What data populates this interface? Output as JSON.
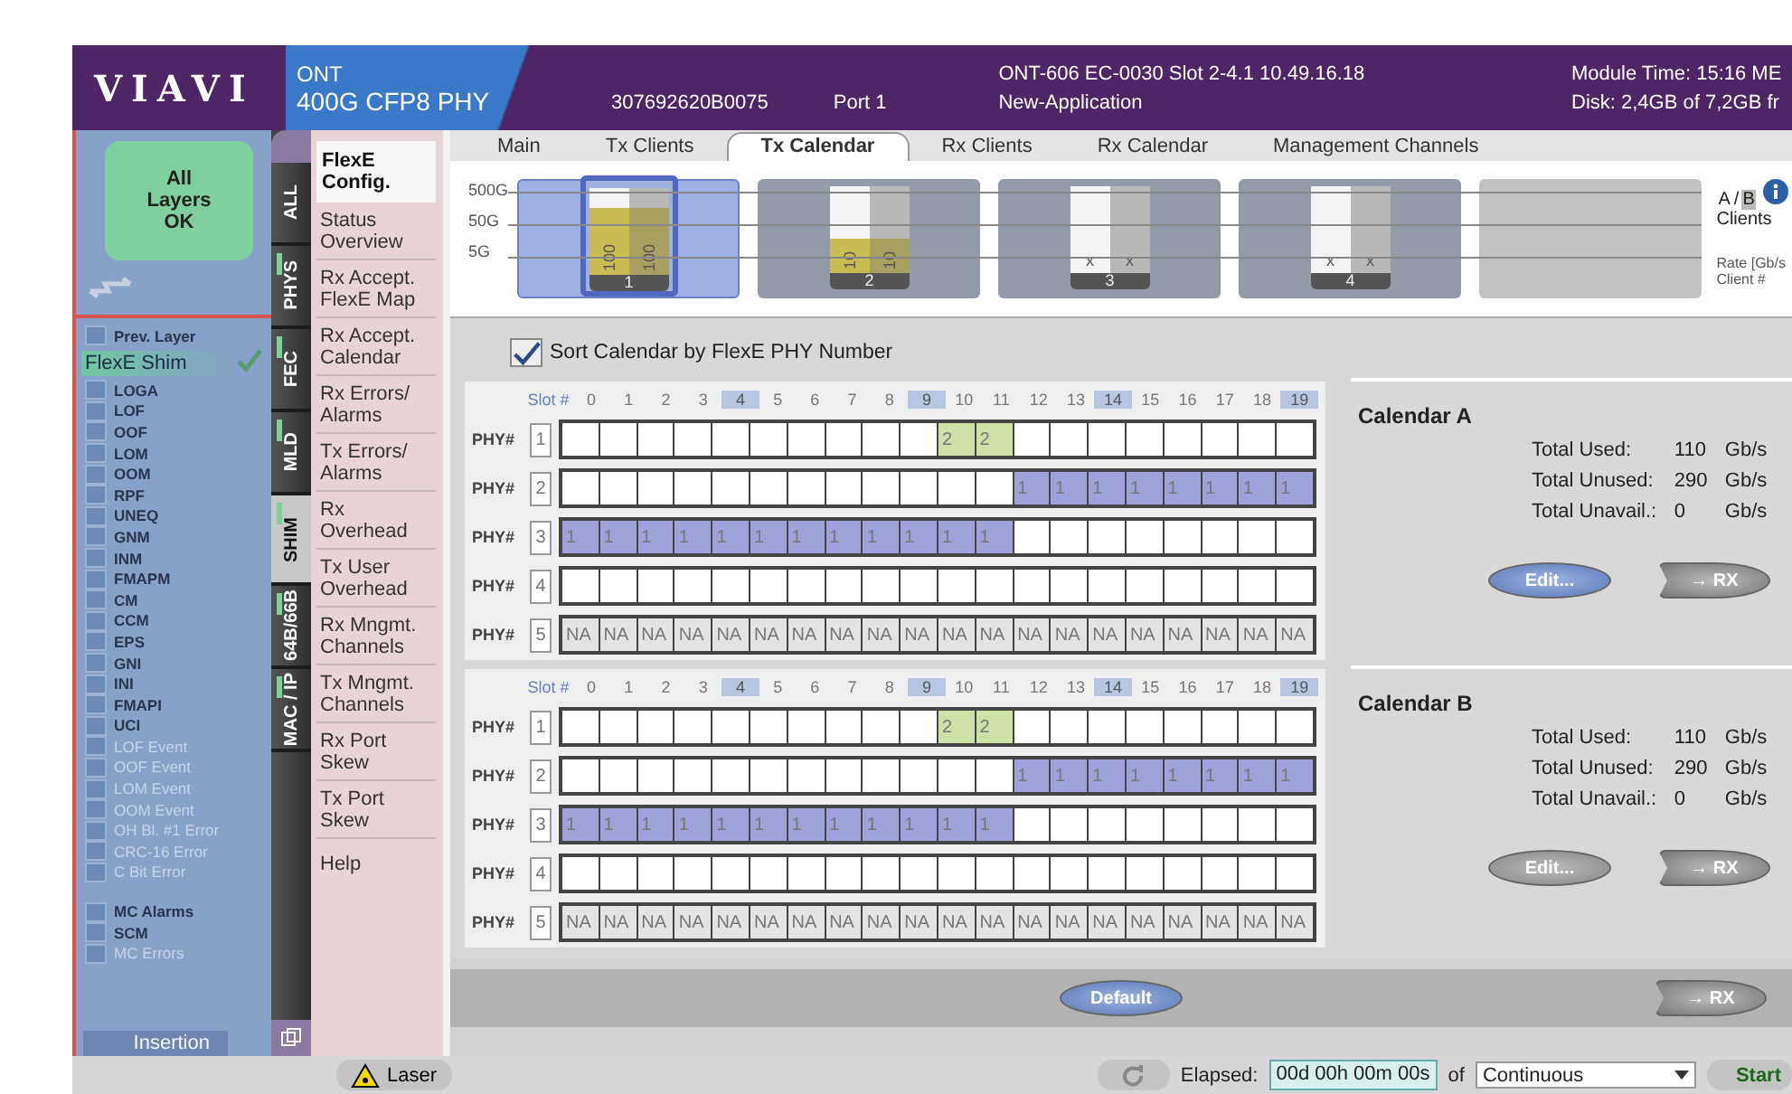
{
  "header": {
    "logo": "VIAVI",
    "product": "ONT",
    "module": "400G CFP8 PHY",
    "serial": "307692620B0075",
    "port": "Port 1",
    "device": "ONT-606 EC-0030 Slot 2-4.1  10.49.16.18",
    "application": "New-Application",
    "module_time": "Module Time: 15:16 ME",
    "disk": "Disk: 2,4GB of 7,2GB fr"
  },
  "status_box": {
    "text": "All Layers OK"
  },
  "prev_layer": {
    "label": "Prev. Layer",
    "checked": false
  },
  "layer": {
    "label": "FlexE Shim",
    "selected": true
  },
  "alarms": [
    {
      "label": "LOGA",
      "disabled": false
    },
    {
      "label": "LOF",
      "disabled": false
    },
    {
      "label": "OOF",
      "disabled": false
    },
    {
      "label": "LOM",
      "disabled": false
    },
    {
      "label": "OOM",
      "disabled": false
    },
    {
      "label": "RPF",
      "disabled": false
    },
    {
      "label": "UNEQ",
      "disabled": false
    },
    {
      "label": "GNM",
      "disabled": false
    },
    {
      "label": "INM",
      "disabled": false
    },
    {
      "label": "FMAPM",
      "disabled": false
    },
    {
      "label": "CM",
      "disabled": false
    },
    {
      "label": "CCM",
      "disabled": false
    },
    {
      "label": "EPS",
      "disabled": false
    },
    {
      "label": "GNI",
      "disabled": false
    },
    {
      "label": "INI",
      "disabled": false
    },
    {
      "label": "FMAPI",
      "disabled": false
    },
    {
      "label": "UCI",
      "disabled": false
    },
    {
      "label": "LOF Event",
      "disabled": true
    },
    {
      "label": "OOF Event",
      "disabled": true
    },
    {
      "label": "LOM Event",
      "disabled": true
    },
    {
      "label": "OOM Event",
      "disabled": true
    },
    {
      "label": "OH Bl. #1 Error",
      "disabled": true
    },
    {
      "label": "CRC-16 Error",
      "disabled": true
    },
    {
      "label": "C Bit Error",
      "disabled": true
    }
  ],
  "mc_alarms": [
    {
      "label": "MC Alarms",
      "disabled": false
    },
    {
      "label": "SCM",
      "disabled": false
    },
    {
      "label": "MC Errors",
      "disabled": true
    }
  ],
  "insertion": {
    "label": "Insertion"
  },
  "layer_tabs": [
    {
      "label": "ALL",
      "selected": false,
      "indicator": false
    },
    {
      "label": "PHYS",
      "selected": false,
      "indicator": true
    },
    {
      "label": "FEC",
      "selected": false,
      "indicator": true
    },
    {
      "label": "MLD",
      "selected": false,
      "indicator": true
    },
    {
      "label": "SHIM",
      "selected": true,
      "indicator": true
    },
    {
      "label": "64B/66B",
      "selected": false,
      "indicator": true
    },
    {
      "label": "MAC / IP",
      "selected": false,
      "indicator": true
    }
  ],
  "menu": [
    {
      "label": "FlexE Config.",
      "selected": true
    },
    {
      "label": "Status Overview",
      "selected": false
    },
    {
      "label": "Rx Accept. FlexE Map",
      "selected": false
    },
    {
      "label": "Rx Accept. Calendar",
      "selected": false
    },
    {
      "label": "Rx Errors/ Alarms",
      "selected": false
    },
    {
      "label": "Tx Errors/ Alarms",
      "selected": false
    },
    {
      "label": "Rx Overhead",
      "selected": false
    },
    {
      "label": "Tx User Overhead",
      "selected": false
    },
    {
      "label": "Rx Mngmt. Channels",
      "selected": false
    },
    {
      "label": "Tx Mngmt. Channels",
      "selected": false
    },
    {
      "label": "Rx Port Skew",
      "selected": false
    },
    {
      "label": "Tx Port Skew",
      "selected": false
    },
    {
      "label": "Help",
      "selected": false
    }
  ],
  "tabs": [
    {
      "label": "Main",
      "selected": false
    },
    {
      "label": "Tx Clients",
      "selected": false
    },
    {
      "label": "Tx Calendar",
      "selected": true
    },
    {
      "label": "Rx Clients",
      "selected": false
    },
    {
      "label": "Rx Calendar",
      "selected": false
    },
    {
      "label": "Management Channels",
      "selected": false
    }
  ],
  "client_chart": {
    "rate_labels": [
      "500G",
      "50G",
      "5G"
    ],
    "groups": [
      {
        "kind": "client",
        "number": "1",
        "selected": true,
        "bars": [
          {
            "text": "100",
            "level": 0.78
          },
          {
            "text": "100",
            "level": 0.78
          }
        ]
      },
      {
        "kind": "client",
        "number": "2",
        "selected": false,
        "bars": [
          {
            "text": "10",
            "level": 0.4
          },
          {
            "text": "10",
            "level": 0.4
          }
        ]
      },
      {
        "kind": "client",
        "number": "3",
        "selected": false,
        "bars": [
          {
            "text": "x",
            "level": 0
          },
          {
            "text": "x",
            "level": 0
          }
        ]
      },
      {
        "kind": "client",
        "number": "4",
        "selected": false,
        "bars": [
          {
            "text": "x",
            "level": 0
          },
          {
            "text": "x",
            "level": 0
          }
        ]
      },
      {
        "kind": "empty"
      }
    ],
    "ab_options": [
      {
        "label": "A",
        "selected": false
      },
      {
        "label": "B",
        "selected": true
      }
    ],
    "ab_separator": "/",
    "clients_label": "Clients",
    "rate_label": "Rate [Gb/s",
    "client_label": "Client #"
  },
  "sort_option": {
    "label": "Sort Calendar by FlexE PHY Number",
    "checked": true
  },
  "calendars": [
    {
      "title": "Calendar A",
      "slot_label": "Slot #",
      "slots": [
        {
          "label": "0",
          "highlighted": false
        },
        {
          "label": "1",
          "highlighted": false
        },
        {
          "label": "2",
          "highlighted": false
        },
        {
          "label": "3",
          "highlighted": false
        },
        {
          "label": "4",
          "highlighted": true
        },
        {
          "label": "5",
          "highlighted": false
        },
        {
          "label": "6",
          "highlighted": false
        },
        {
          "label": "7",
          "highlighted": false
        },
        {
          "label": "8",
          "highlighted": false
        },
        {
          "label": "9",
          "highlighted": true
        },
        {
          "label": "10",
          "highlighted": false
        },
        {
          "label": "11",
          "highlighted": false
        },
        {
          "label": "12",
          "highlighted": false
        },
        {
          "label": "13",
          "highlighted": false
        },
        {
          "label": "14",
          "highlighted": true
        },
        {
          "label": "15",
          "highlighted": false
        },
        {
          "label": "16",
          "highlighted": false
        },
        {
          "label": "17",
          "highlighted": false
        },
        {
          "label": "18",
          "highlighted": false
        },
        {
          "label": "19",
          "highlighted": true
        }
      ],
      "rows": [
        {
          "phy_label": "PHY#",
          "phy": "1",
          "cells": [
            null,
            null,
            null,
            null,
            null,
            null,
            null,
            null,
            null,
            null,
            {
              "text": "2",
              "color": "#cde0a6"
            },
            {
              "text": "2",
              "color": "#cde0a6"
            },
            null,
            null,
            null,
            null,
            null,
            null,
            null,
            null
          ]
        },
        {
          "phy_label": "PHY#",
          "phy": "2",
          "cells": [
            null,
            null,
            null,
            null,
            null,
            null,
            null,
            null,
            null,
            null,
            null,
            null,
            {
              "text": "1",
              "color": "#9ea2d9"
            },
            {
              "text": "1",
              "color": "#9ea2d9"
            },
            {
              "text": "1",
              "color": "#9ea2d9"
            },
            {
              "text": "1",
              "color": "#9ea2d9"
            },
            {
              "text": "1",
              "color": "#9ea2d9"
            },
            {
              "text": "1",
              "color": "#9ea2d9"
            },
            {
              "text": "1",
              "color": "#9ea2d9"
            },
            {
              "text": "1",
              "color": "#9ea2d9"
            }
          ]
        },
        {
          "phy_label": "PHY#",
          "phy": "3",
          "cells": [
            {
              "text": "1",
              "color": "#9ea2d9"
            },
            {
              "text": "1",
              "color": "#9ea2d9"
            },
            {
              "text": "1",
              "color": "#9ea2d9"
            },
            {
              "text": "1",
              "color": "#9ea2d9"
            },
            {
              "text": "1",
              "color": "#9ea2d9"
            },
            {
              "text": "1",
              "color": "#9ea2d9"
            },
            {
              "text": "1",
              "color": "#9ea2d9"
            },
            {
              "text": "1",
              "color": "#9ea2d9"
            },
            {
              "text": "1",
              "color": "#9ea2d9"
            },
            {
              "text": "1",
              "color": "#9ea2d9"
            },
            {
              "text": "1",
              "color": "#9ea2d9"
            },
            {
              "text": "1",
              "color": "#9ea2d9"
            },
            null,
            null,
            null,
            null,
            null,
            null,
            null,
            null
          ]
        },
        {
          "phy_label": "PHY#",
          "phy": "4",
          "cells": [
            null,
            null,
            null,
            null,
            null,
            null,
            null,
            null,
            null,
            null,
            null,
            null,
            null,
            null,
            null,
            null,
            null,
            null,
            null,
            null
          ]
        },
        {
          "phy_label": "PHY#",
          "phy": "5",
          "cells": [
            {
              "text": "NA",
              "color": "#e4e4e4"
            },
            {
              "text": "NA",
              "color": "#e4e4e4"
            },
            {
              "text": "NA",
              "color": "#e4e4e4"
            },
            {
              "text": "NA",
              "color": "#e4e4e4"
            },
            {
              "text": "NA",
              "color": "#e4e4e4"
            },
            {
              "text": "NA",
              "color": "#e4e4e4"
            },
            {
              "text": "NA",
              "color": "#e4e4e4"
            },
            {
              "text": "NA",
              "color": "#e4e4e4"
            },
            {
              "text": "NA",
              "color": "#e4e4e4"
            },
            {
              "text": "NA",
              "color": "#e4e4e4"
            },
            {
              "text": "NA",
              "color": "#e4e4e4"
            },
            {
              "text": "NA",
              "color": "#e4e4e4"
            },
            {
              "text": "NA",
              "color": "#e4e4e4"
            },
            {
              "text": "NA",
              "color": "#e4e4e4"
            },
            {
              "text": "NA",
              "color": "#e4e4e4"
            },
            {
              "text": "NA",
              "color": "#e4e4e4"
            },
            {
              "text": "NA",
              "color": "#e4e4e4"
            },
            {
              "text": "NA",
              "color": "#e4e4e4"
            },
            {
              "text": "NA",
              "color": "#e4e4e4"
            },
            {
              "text": "NA",
              "color": "#e4e4e4"
            }
          ]
        }
      ],
      "stats": [
        {
          "label": "Total Used:",
          "value": "110",
          "unit": "Gb/s"
        },
        {
          "label": "Total Unused:",
          "value": "290",
          "unit": "Gb/s"
        },
        {
          "label": "Total Unavail.:",
          "value": "0",
          "unit": "Gb/s"
        }
      ],
      "edit_button": {
        "label": "Edit...",
        "active": true
      },
      "rx_button": {
        "label": "→ RX"
      }
    },
    {
      "title": "Calendar B",
      "slot_label": "Slot #",
      "slots": [
        {
          "label": "0",
          "highlighted": false
        },
        {
          "label": "1",
          "highlighted": false
        },
        {
          "label": "2",
          "highlighted": false
        },
        {
          "label": "3",
          "highlighted": false
        },
        {
          "label": "4",
          "highlighted": true
        },
        {
          "label": "5",
          "highlighted": false
        },
        {
          "label": "6",
          "highlighted": false
        },
        {
          "label": "7",
          "highlighted": false
        },
        {
          "label": "8",
          "highlighted": false
        },
        {
          "label": "9",
          "highlighted": true
        },
        {
          "label": "10",
          "highlighted": false
        },
        {
          "label": "11",
          "highlighted": false
        },
        {
          "label": "12",
          "highlighted": false
        },
        {
          "label": "13",
          "highlighted": false
        },
        {
          "label": "14",
          "highlighted": true
        },
        {
          "label": "15",
          "highlighted": false
        },
        {
          "label": "16",
          "highlighted": false
        },
        {
          "label": "17",
          "highlighted": false
        },
        {
          "label": "18",
          "highlighted": false
        },
        {
          "label": "19",
          "highlighted": true
        }
      ],
      "rows": [
        {
          "phy_label": "PHY#",
          "phy": "1",
          "cells": [
            null,
            null,
            null,
            null,
            null,
            null,
            null,
            null,
            null,
            null,
            {
              "text": "2",
              "color": "#cde0a6"
            },
            {
              "text": "2",
              "color": "#cde0a6"
            },
            null,
            null,
            null,
            null,
            null,
            null,
            null,
            null
          ]
        },
        {
          "phy_label": "PHY#",
          "phy": "2",
          "cells": [
            null,
            null,
            null,
            null,
            null,
            null,
            null,
            null,
            null,
            null,
            null,
            null,
            {
              "text": "1",
              "color": "#9ea2d9"
            },
            {
              "text": "1",
              "color": "#9ea2d9"
            },
            {
              "text": "1",
              "color": "#9ea2d9"
            },
            {
              "text": "1",
              "color": "#9ea2d9"
            },
            {
              "text": "1",
              "color": "#9ea2d9"
            },
            {
              "text": "1",
              "color": "#9ea2d9"
            },
            {
              "text": "1",
              "color": "#9ea2d9"
            },
            {
              "text": "1",
              "color": "#9ea2d9"
            }
          ]
        },
        {
          "phy_label": "PHY#",
          "phy": "3",
          "cells": [
            {
              "text": "1",
              "color": "#9ea2d9"
            },
            {
              "text": "1",
              "color": "#9ea2d9"
            },
            {
              "text": "1",
              "color": "#9ea2d9"
            },
            {
              "text": "1",
              "color": "#9ea2d9"
            },
            {
              "text": "1",
              "color": "#9ea2d9"
            },
            {
              "text": "1",
              "color": "#9ea2d9"
            },
            {
              "text": "1",
              "color": "#9ea2d9"
            },
            {
              "text": "1",
              "color": "#9ea2d9"
            },
            {
              "text": "1",
              "color": "#9ea2d9"
            },
            {
              "text": "1",
              "color": "#9ea2d9"
            },
            {
              "text": "1",
              "color": "#9ea2d9"
            },
            {
              "text": "1",
              "color": "#9ea2d9"
            },
            null,
            null,
            null,
            null,
            null,
            null,
            null,
            null
          ]
        },
        {
          "phy_label": "PHY#",
          "phy": "4",
          "cells": [
            null,
            null,
            null,
            null,
            null,
            null,
            null,
            null,
            null,
            null,
            null,
            null,
            null,
            null,
            null,
            null,
            null,
            null,
            null,
            null
          ]
        },
        {
          "phy_label": "PHY#",
          "phy": "5",
          "cells": [
            {
              "text": "NA",
              "color": "#e4e4e4"
            },
            {
              "text": "NA",
              "color": "#e4e4e4"
            },
            {
              "text": "NA",
              "color": "#e4e4e4"
            },
            {
              "text": "NA",
              "color": "#e4e4e4"
            },
            {
              "text": "NA",
              "color": "#e4e4e4"
            },
            {
              "text": "NA",
              "color": "#e4e4e4"
            },
            {
              "text": "NA",
              "color": "#e4e4e4"
            },
            {
              "text": "NA",
              "color": "#e4e4e4"
            },
            {
              "text": "NA",
              "color": "#e4e4e4"
            },
            {
              "text": "NA",
              "color": "#e4e4e4"
            },
            {
              "text": "NA",
              "color": "#e4e4e4"
            },
            {
              "text": "NA",
              "color": "#e4e4e4"
            },
            {
              "text": "NA",
              "color": "#e4e4e4"
            },
            {
              "text": "NA",
              "color": "#e4e4e4"
            },
            {
              "text": "NA",
              "color": "#e4e4e4"
            },
            {
              "text": "NA",
              "color": "#e4e4e4"
            },
            {
              "text": "NA",
              "color": "#e4e4e4"
            },
            {
              "text": "NA",
              "color": "#e4e4e4"
            },
            {
              "text": "NA",
              "color": "#e4e4e4"
            },
            {
              "text": "NA",
              "color": "#e4e4e4"
            }
          ]
        }
      ],
      "stats": [
        {
          "label": "Total Used:",
          "value": "110",
          "unit": "Gb/s"
        },
        {
          "label": "Total Unused:",
          "value": "290",
          "unit": "Gb/s"
        },
        {
          "label": "Total Unavail.:",
          "value": "0",
          "unit": "Gb/s"
        }
      ],
      "edit_button": {
        "label": "Edit...",
        "active": false
      },
      "rx_button": {
        "label": "→ RX"
      }
    }
  ],
  "default_button": {
    "label": "Default"
  },
  "bottom_rx_button": {
    "label": "→ RX"
  },
  "status_bar": {
    "laser": "Laser",
    "elapsed_label": "Elapsed:",
    "elapsed": "00d 00h 00m 00s",
    "of": "of",
    "mode": "Continuous",
    "start": "Start"
  }
}
